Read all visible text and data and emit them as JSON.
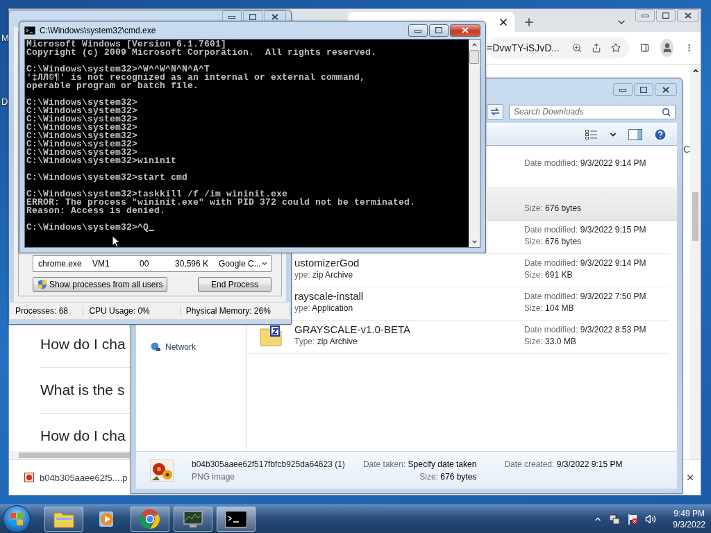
{
  "desktop": {
    "icon_labels": [
      "M",
      "D"
    ]
  },
  "browser": {
    "url": "=DvwTY-iSJvD...",
    "page_items": [
      "How do I cha",
      "What is the s",
      "How do I cha"
    ],
    "edge_text": "C",
    "download": {
      "filename": "b04b305aaee62f5....p"
    }
  },
  "task_manager": {
    "process_cells": [
      "chrome.exe",
      "VM1",
      "00",
      "30,596 K",
      "Google C..."
    ],
    "buttons": [
      {
        "label": "Show processes from all users",
        "kind": "shield"
      },
      {
        "label": "End Process",
        "kind": "plain"
      }
    ],
    "status": [
      "Processes: 68",
      "CPU Usage: 0%",
      "Physical Memory: 26%"
    ]
  },
  "explorer": {
    "search": {
      "placeholder": "Search Downloads"
    },
    "nav": [
      {
        "label": "Network"
      }
    ],
    "files": [
      {
        "kind": "covered",
        "date_label": "Date modified:",
        "date": "9/3/2022 9:14 PM",
        "selected": false
      },
      {
        "kind": "covered",
        "size_label": "Size:",
        "size": "676 bytes",
        "selected": true
      },
      {
        "kind": "covered",
        "date_label": "Date modified:",
        "date": "9/3/2022 9:15 PM",
        "size_label": "Size:",
        "size": "676 bytes",
        "selected": false
      },
      {
        "kind": "text",
        "name": "ustomizerGod",
        "type_label": "ype:",
        "type": "zip Archive",
        "date_label": "Date modified:",
        "date": "9/3/2022 9:14 PM",
        "size_label": "Size:",
        "size": "691 KB",
        "selected": false
      },
      {
        "kind": "text",
        "name": "rayscale-install",
        "type_label": "ype:",
        "type": "Application",
        "date_label": "Date modified:",
        "date": "9/3/2022 7:50 PM",
        "size_label": "Size:",
        "size": "104 MB",
        "selected": false
      },
      {
        "kind": "zip",
        "name": "GRAYSCALE-v1.0-BETA",
        "type_label": "Type:",
        "type": "zip Archive",
        "date_label": "Date modified:",
        "date": "9/3/2022 8:53 PM",
        "size_label": "Size:",
        "size": "33.0 MB",
        "selected": false
      }
    ],
    "details": {
      "name": "b04b305aaee62f517fbfcb925da64623 (1)",
      "type": "PNG image",
      "fields": [
        {
          "label": "Date taken:",
          "value": "Specify date taken"
        },
        {
          "label": "Size:",
          "value": "676 bytes"
        },
        {
          "label": "Date created:",
          "value": "9/3/2022 9:15 PM"
        }
      ]
    }
  },
  "cmd": {
    "title": "C:\\Windows\\system32\\cmd.exe",
    "cursor_visible": true,
    "blocks": [
      [
        "Microsoft Windows [Version 6.1.7601]",
        "Copyright (c) 2009 Microsoft Corporation.  All rights reserved."
      ],
      [
        "C:\\Windows\\system32>^W^^W^N^N^A^T",
        "'‡ЛЛ©¶' is not recognized as an internal or external command,",
        "operable program or batch file."
      ],
      [
        "C:\\Windows\\system32>",
        "C:\\Windows\\system32>",
        "C:\\Windows\\system32>",
        "C:\\Windows\\system32>",
        "C:\\Windows\\system32>",
        "C:\\Windows\\system32>",
        "C:\\Windows\\system32>",
        "C:\\Windows\\system32>wininit"
      ],
      [
        "C:\\Windows\\system32>start cmd"
      ],
      [
        "C:\\Windows\\system32>taskkill /f /im wininit.exe",
        "ERROR: The process \"wininit.exe\" with PID 372 could not be terminated.",
        "Reason: Access is denied."
      ],
      [
        "C:\\Windows\\system32>^Q"
      ]
    ]
  },
  "taskbar": {
    "apps": [
      {
        "kind": "explorer",
        "running": true,
        "selected": false
      },
      {
        "kind": "media",
        "running": false,
        "selected": false
      },
      {
        "kind": "chrome",
        "running": true,
        "selected": false
      },
      {
        "kind": "taskmgr",
        "running": true,
        "selected": false
      },
      {
        "kind": "cmd",
        "running": true,
        "selected": true
      }
    ],
    "time": "9:49 PM",
    "date": "9/3/2022"
  }
}
